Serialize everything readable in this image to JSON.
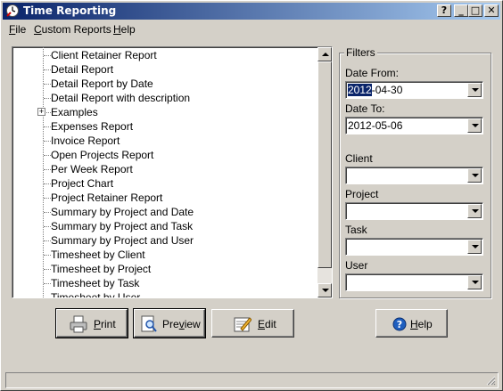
{
  "window": {
    "title": "Time Reporting",
    "controls": {
      "help": "?",
      "minimize": "_",
      "maximize": "□",
      "close": "✕"
    }
  },
  "menu": [
    {
      "label": "File",
      "accel": "F",
      "rest": "ile"
    },
    {
      "label": "Custom Reports",
      "accel": "C",
      "rest": "ustom Reports"
    },
    {
      "label": "Help",
      "accel": "H",
      "rest": "elp"
    }
  ],
  "reports": [
    {
      "label": "Client Retainer Report",
      "expandable": false
    },
    {
      "label": "Detail Report",
      "expandable": false
    },
    {
      "label": "Detail Report by Date",
      "expandable": false
    },
    {
      "label": "Detail Report with description",
      "expandable": false
    },
    {
      "label": "Examples",
      "expandable": true
    },
    {
      "label": "Expenses Report",
      "expandable": false
    },
    {
      "label": "Invoice Report",
      "expandable": false
    },
    {
      "label": "Open Projects Report",
      "expandable": false
    },
    {
      "label": "Per Week Report",
      "expandable": false
    },
    {
      "label": "Project Chart",
      "expandable": false
    },
    {
      "label": "Project Retainer Report",
      "expandable": false
    },
    {
      "label": "Summary by Project and Date",
      "expandable": false
    },
    {
      "label": "Summary by Project and Task",
      "expandable": false
    },
    {
      "label": "Summary by Project and User",
      "expandable": false
    },
    {
      "label": "Timesheet by Client",
      "expandable": false
    },
    {
      "label": "Timesheet by Project",
      "expandable": false
    },
    {
      "label": "Timesheet by Task",
      "expandable": false
    },
    {
      "label": "Timesheet by User",
      "expandable": false
    }
  ],
  "filters": {
    "title": "Filters",
    "date_from": {
      "label": "Date From:",
      "value_selected": "2012",
      "value_rest": "-04-30"
    },
    "date_to": {
      "label": "Date To:",
      "value": "2012-05-06"
    },
    "client": {
      "label": "Client",
      "value": ""
    },
    "project": {
      "label": "Project",
      "value": ""
    },
    "task": {
      "label": "Task",
      "value": ""
    },
    "user": {
      "label": "User",
      "value": ""
    }
  },
  "buttons": {
    "print": {
      "accel": "P",
      "rest": "rint"
    },
    "preview": {
      "pre": "Pre",
      "accel": "v",
      "rest": "iew"
    },
    "edit": {
      "accel": "E",
      "rest": "dit"
    },
    "help": {
      "accel": "H",
      "rest": "elp"
    }
  },
  "status": ""
}
